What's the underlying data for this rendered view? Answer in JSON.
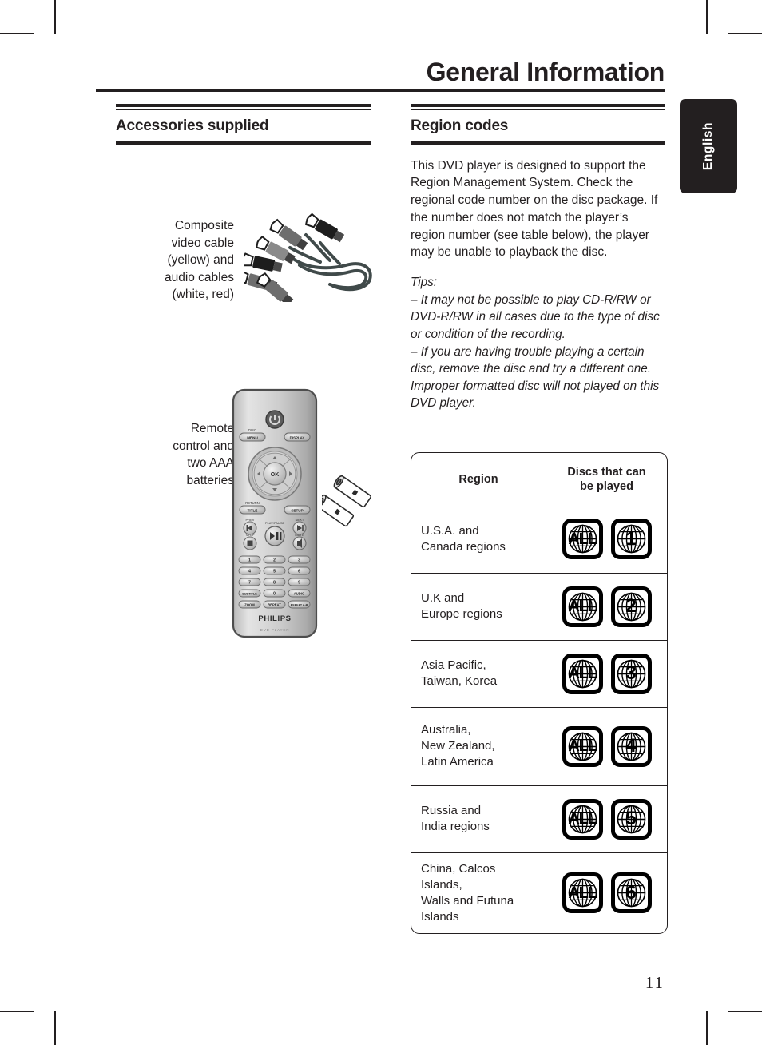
{
  "page": {
    "title": "General Information",
    "language_tab": "English",
    "page_number": "11"
  },
  "left_column": {
    "section_title": "Accessories supplied",
    "accessories": [
      {
        "label": "Composite\nvideo cable\n(yellow) and\naudio cables\n(white, red)",
        "label_line_1": "Composite",
        "label_line_2": "video cable",
        "label_line_3": "(yellow) and",
        "label_line_4": "audio cables",
        "label_line_5": "(white, red)",
        "image": "rca-cable-bundle"
      },
      {
        "label_line_1": "Remote",
        "label_line_2": "control and",
        "label_line_3": "two AAA",
        "label_line_4": "batteries",
        "image": "remote-control-and-batteries"
      }
    ]
  },
  "remote": {
    "brand": "PHILIPS",
    "model_text": "DVD PLAYER",
    "buttons": {
      "power": "power-icon",
      "disc_menu_top": "DISC",
      "disc_menu": "MENU",
      "display": "DISPLAY",
      "ok": "OK",
      "return_top": "RETURN",
      "title": "TITLE",
      "setup": "SETUP",
      "prev_top": "PREV",
      "next_top": "NEXT",
      "play_pause_top": "PLAY/PAUSE",
      "stop_top": "STOP",
      "mute_top": "MUTE",
      "keypad": [
        "1",
        "2",
        "3",
        "4",
        "5",
        "6",
        "7",
        "8",
        "9"
      ],
      "subtitle": "SUBTITLE",
      "zero": "0",
      "audio": "AUDIO",
      "zoom": "ZOOM",
      "repeat": "REPEAT",
      "repeat_ab": "REPEAT A-B"
    }
  },
  "right_column": {
    "section_title": "Region codes",
    "body_paragraph": "This DVD player is designed to support the Region Management System. Check the regional code number on the disc package. If the number does not match the player’s region number (see table below), the player may be unable to playback the disc.",
    "tips_label": "Tips:",
    "tips": [
      "– It may not be possible to play CD-R/RW or DVD-R/RW in all cases due to the type of disc or condition of the recording.",
      "– If you are having trouble playing a certain disc, remove the disc and try a different one. Improper formatted disc will not played on this DVD player."
    ]
  },
  "region_table": {
    "headers": [
      "Region",
      "Discs that can\nbe played"
    ],
    "header_region": "Region",
    "header_discs_line1": "Discs that can",
    "header_discs_line2": "be played",
    "rows": [
      {
        "region_lines": [
          "U.S.A. and",
          "Canada regions"
        ],
        "badges": [
          "ALL",
          "1"
        ]
      },
      {
        "region_lines": [
          "U.K and",
          "Europe regions"
        ],
        "badges": [
          "ALL",
          "2"
        ]
      },
      {
        "region_lines": [
          "Asia Pacific,",
          "Taiwan, Korea"
        ],
        "badges": [
          "ALL",
          "3"
        ]
      },
      {
        "region_lines": [
          "Australia,",
          "New Zealand,",
          "Latin America"
        ],
        "badges": [
          "ALL",
          "4"
        ]
      },
      {
        "region_lines": [
          "Russia and",
          "India regions"
        ],
        "badges": [
          "ALL",
          "5"
        ]
      },
      {
        "region_lines": [
          "China, Calcos Islands,",
          "Walls and Futuna",
          "Islands"
        ],
        "badges": [
          "ALL",
          "6"
        ]
      }
    ]
  },
  "colors": {
    "ink": "#231f20",
    "paper": "#ffffff",
    "tab_background": "#231f20",
    "tab_text": "#ffffff"
  }
}
